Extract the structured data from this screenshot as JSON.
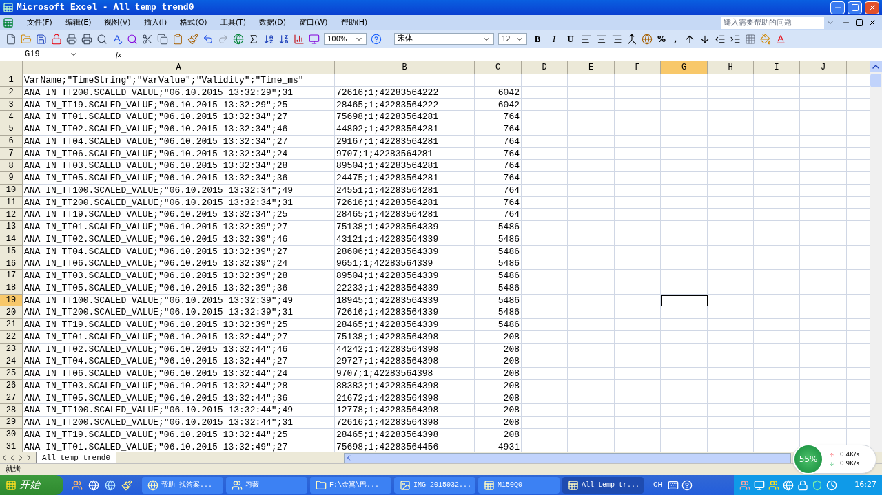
{
  "window": {
    "title": "Microsoft Excel - All temp trend0"
  },
  "menu": [
    "文件(F)",
    "编辑(E)",
    "视图(V)",
    "插入(I)",
    "格式(O)",
    "工具(T)",
    "数据(D)",
    "窗口(W)",
    "帮助(H)"
  ],
  "help_box": {
    "placeholder": "键入需要帮助的问题"
  },
  "toolbar": {
    "zoom": "100%",
    "font": "宋体",
    "font_size": "12",
    "format_buttons": [
      "B",
      "I",
      "U"
    ],
    "number_buttons": [
      "%",
      ","
    ]
  },
  "formula_bar": {
    "name_box": "G19",
    "fx": "fx"
  },
  "columns": [
    {
      "label": "A",
      "selected": false
    },
    {
      "label": "B",
      "selected": false
    },
    {
      "label": "C",
      "selected": false
    },
    {
      "label": "D",
      "selected": false
    },
    {
      "label": "E",
      "selected": false
    },
    {
      "label": "F",
      "selected": false
    },
    {
      "label": "G",
      "selected": true
    },
    {
      "label": "H",
      "selected": false
    },
    {
      "label": "I",
      "selected": false
    },
    {
      "label": "J",
      "selected": false
    }
  ],
  "rows": [
    {
      "n": "1",
      "a": "VarName;\"TimeString\";\"VarValue\";\"Validity\";\"Time_ms\"",
      "b": "",
      "c": "",
      "selected": false
    },
    {
      "n": "2",
      "a": "ANA IN_TT200.SCALED_VALUE;\"06.10.2015 13:32:29\";31",
      "b": "72616;1;42283564222",
      "c": "6042",
      "selected": false
    },
    {
      "n": "3",
      "a": "ANA IN_TT19.SCALED_VALUE;\"06.10.2015 13:32:29\";25",
      "b": "28465;1;42283564222",
      "c": "6042",
      "selected": false
    },
    {
      "n": "4",
      "a": "ANA IN_TT01.SCALED_VALUE;\"06.10.2015 13:32:34\";27",
      "b": "75698;1;42283564281",
      "c": "764",
      "selected": false
    },
    {
      "n": "5",
      "a": "ANA IN_TT02.SCALED_VALUE;\"06.10.2015 13:32:34\";46",
      "b": "44802;1;42283564281",
      "c": "764",
      "selected": false
    },
    {
      "n": "6",
      "a": "ANA IN_TT04.SCALED_VALUE;\"06.10.2015 13:32:34\";27",
      "b": "29167;1;42283564281",
      "c": "764",
      "selected": false
    },
    {
      "n": "7",
      "a": "ANA IN_TT06.SCALED_VALUE;\"06.10.2015 13:32:34\";24",
      "b": "9707;1;42283564281",
      "c": "764",
      "selected": false
    },
    {
      "n": "8",
      "a": "ANA IN_TT03.SCALED_VALUE;\"06.10.2015 13:32:34\";28",
      "b": "89504;1;42283564281",
      "c": "764",
      "selected": false
    },
    {
      "n": "9",
      "a": "ANA IN_TT05.SCALED_VALUE;\"06.10.2015 13:32:34\";36",
      "b": "24475;1;42283564281",
      "c": "764",
      "selected": false
    },
    {
      "n": "10",
      "a": "ANA IN_TT100.SCALED_VALUE;\"06.10.2015 13:32:34\";49",
      "b": "24551;1;42283564281",
      "c": "764",
      "selected": false
    },
    {
      "n": "11",
      "a": "ANA IN_TT200.SCALED_VALUE;\"06.10.2015 13:32:34\";31",
      "b": "72616;1;42283564281",
      "c": "764",
      "selected": false
    },
    {
      "n": "12",
      "a": "ANA IN_TT19.SCALED_VALUE;\"06.10.2015 13:32:34\";25",
      "b": "28465;1;42283564281",
      "c": "764",
      "selected": false
    },
    {
      "n": "13",
      "a": "ANA IN_TT01.SCALED_VALUE;\"06.10.2015 13:32:39\";27",
      "b": "75138;1;42283564339",
      "c": "5486",
      "selected": false
    },
    {
      "n": "14",
      "a": "ANA IN_TT02.SCALED_VALUE;\"06.10.2015 13:32:39\";46",
      "b": "43121;1;42283564339",
      "c": "5486",
      "selected": false
    },
    {
      "n": "15",
      "a": "ANA IN_TT04.SCALED_VALUE;\"06.10.2015 13:32:39\";27",
      "b": "28606;1;42283564339",
      "c": "5486",
      "selected": false
    },
    {
      "n": "16",
      "a": "ANA IN_TT06.SCALED_VALUE;\"06.10.2015 13:32:39\";24",
      "b": "9651;1;42283564339",
      "c": "5486",
      "selected": false
    },
    {
      "n": "17",
      "a": "ANA IN_TT03.SCALED_VALUE;\"06.10.2015 13:32:39\";28",
      "b": "89504;1;42283564339",
      "c": "5486",
      "selected": false
    },
    {
      "n": "18",
      "a": "ANA IN_TT05.SCALED_VALUE;\"06.10.2015 13:32:39\";36",
      "b": "22233;1;42283564339",
      "c": "5486",
      "selected": false
    },
    {
      "n": "19",
      "a": "ANA IN_TT100.SCALED_VALUE;\"06.10.2015 13:32:39\";49",
      "b": "18945;1;42283564339",
      "c": "5486",
      "selected": true
    },
    {
      "n": "20",
      "a": "ANA IN_TT200.SCALED_VALUE;\"06.10.2015 13:32:39\";31",
      "b": "72616;1;42283564339",
      "c": "5486",
      "selected": false
    },
    {
      "n": "21",
      "a": "ANA IN_TT19.SCALED_VALUE;\"06.10.2015 13:32:39\";25",
      "b": "28465;1;42283564339",
      "c": "5486",
      "selected": false
    },
    {
      "n": "22",
      "a": "ANA IN_TT01.SCALED_VALUE;\"06.10.2015 13:32:44\";27",
      "b": "75138;1;42283564398",
      "c": "208",
      "selected": false
    },
    {
      "n": "23",
      "a": "ANA IN_TT02.SCALED_VALUE;\"06.10.2015 13:32:44\";46",
      "b": "44242;1;42283564398",
      "c": "208",
      "selected": false
    },
    {
      "n": "24",
      "a": "ANA IN_TT04.SCALED_VALUE;\"06.10.2015 13:32:44\";27",
      "b": "29727;1;42283564398",
      "c": "208",
      "selected": false
    },
    {
      "n": "25",
      "a": "ANA IN_TT06.SCALED_VALUE;\"06.10.2015 13:32:44\";24",
      "b": "9707;1;42283564398",
      "c": "208",
      "selected": false
    },
    {
      "n": "26",
      "a": "ANA IN_TT03.SCALED_VALUE;\"06.10.2015 13:32:44\";28",
      "b": "88383;1;42283564398",
      "c": "208",
      "selected": false
    },
    {
      "n": "27",
      "a": "ANA IN_TT05.SCALED_VALUE;\"06.10.2015 13:32:44\";36",
      "b": "21672;1;42283564398",
      "c": "208",
      "selected": false
    },
    {
      "n": "28",
      "a": "ANA IN_TT100.SCALED_VALUE;\"06.10.2015 13:32:44\";49",
      "b": "12778;1;42283564398",
      "c": "208",
      "selected": false
    },
    {
      "n": "29",
      "a": "ANA IN_TT200.SCALED_VALUE;\"06.10.2015 13:32:44\";31",
      "b": "72616;1;42283564398",
      "c": "208",
      "selected": false
    },
    {
      "n": "30",
      "a": "ANA IN_TT19.SCALED_VALUE;\"06.10.2015 13:32:44\";25",
      "b": "28465;1;42283564398",
      "c": "208",
      "selected": false
    },
    {
      "n": "31",
      "a": "ANA IN_TT01.SCALED_VALUE;\"06.10.2015 13:32:49\";27",
      "b": "75698;1;42283564456",
      "c": "4931",
      "selected": false
    }
  ],
  "sheet_tabs": [
    {
      "label": "All temp trend0",
      "selected": true
    }
  ],
  "status_bar": {
    "text": "就绪"
  },
  "network_widget": {
    "percent": "55%",
    "upload": "0.4K/s",
    "download": "0.9K/s"
  },
  "taskbar": {
    "start": "开始",
    "items": [
      {
        "label": "帮助-找答案...",
        "selected": false
      },
      {
        "label": "习薇",
        "selected": false
      },
      {
        "label": "F:\\金翼\\巴...",
        "selected": false
      },
      {
        "label": "IMG_2015032...",
        "selected": false
      },
      {
        "label": "M150Q0",
        "selected": false
      },
      {
        "label": "All temp tr...",
        "selected": true
      }
    ],
    "language": "CH",
    "clock": "16:27"
  }
}
